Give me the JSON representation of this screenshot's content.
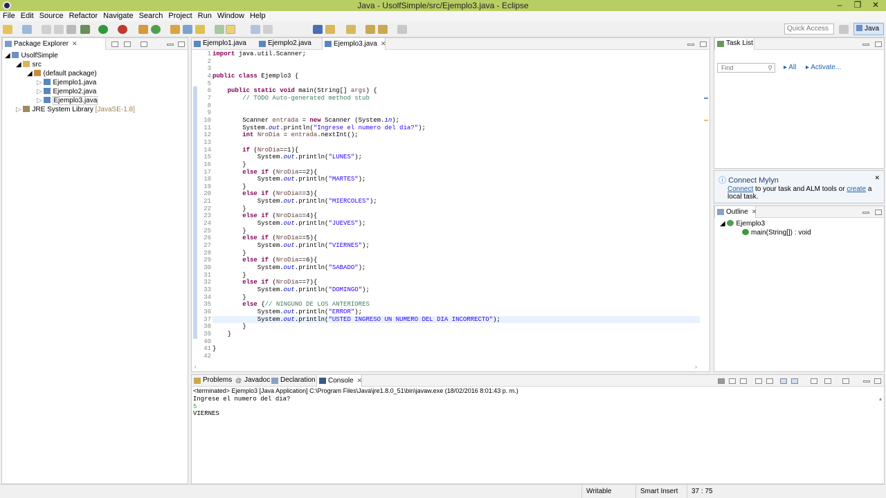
{
  "window": {
    "title": "Java - UsolfSimple/src/Ejemplo3.java - Eclipse"
  },
  "menu": [
    "File",
    "Edit",
    "Source",
    "Refactor",
    "Navigate",
    "Search",
    "Project",
    "Run",
    "Window",
    "Help"
  ],
  "toolbar": {
    "quick_access_placeholder": "Quick Access",
    "perspective": "Java"
  },
  "package_explorer": {
    "tab": "Package Explorer",
    "project": "UsolfSimple",
    "src": "src",
    "package": "(default package)",
    "files": [
      "Ejemplo1.java",
      "Ejemplo2.java",
      "Ejemplo3.java"
    ],
    "library": "JRE System Library",
    "library_version": "[JavaSE-1.8]"
  },
  "editor": {
    "tabs": [
      "Ejemplo1.java",
      "Ejemplo2.java",
      "Ejemplo3.java"
    ],
    "active_tab": "Ejemplo3.java",
    "lines": [
      "import java.util.Scanner;",
      "",
      "",
      "public class Ejemplo3 {",
      "",
      "    public static void main(String[] args) {",
      "        // TODO Auto-generated method stub",
      "",
      "",
      "        Scanner entrada = new Scanner (System.in);",
      "        System.out.println(\"Ingrese el numero del dia?\");",
      "        int NroDia = entrada.nextInt();",
      "",
      "        if (NroDia==1){",
      "            System.out.println(\"LUNES\");",
      "        }",
      "        else if (NroDia==2){",
      "            System.out.println(\"MARTES\");",
      "        }",
      "        else if (NroDia==3){",
      "            System.out.println(\"MIERCOLES\");",
      "        }",
      "        else if (NroDia==4){",
      "            System.out.println(\"JUEVES\");",
      "        }",
      "        else if (NroDia==5){",
      "            System.out.println(\"VIERNES\");",
      "        }",
      "        else if (NroDia==6){",
      "            System.out.println(\"SABADO\");",
      "        }",
      "        else if (NroDia==7){",
      "            System.out.println(\"DOMINGO\");",
      "        }",
      "        else {// NINGUNO DE LOS ANTERIORES",
      "            System.out.println(\"ERROR\");",
      "            System.out.println(\"USTED INGRESO UN NUMERO DEL DIA INCORRECTO\");",
      "        }",
      "    }",
      "",
      "}",
      ""
    ],
    "current_line": 37
  },
  "task_list": {
    "tab": "Task List",
    "find_placeholder": "Find",
    "all": "All",
    "activate": "Activate..."
  },
  "mylyn": {
    "title": "Connect Mylyn",
    "connect_link": "Connect",
    "text_mid": " to your task and ALM tools or ",
    "create_link": "create",
    "text_end": " a local task."
  },
  "outline": {
    "tab": "Outline",
    "class": "Ejemplo3",
    "method": "main(String[]) : void"
  },
  "bottom_tabs": [
    "Problems",
    "Javadoc",
    "Declaration",
    "Console"
  ],
  "console": {
    "header": "<terminated> Ejemplo3 [Java Application] C:\\Program Files\\Java\\jre1.8.0_51\\bin\\javaw.exe (18/02/2016 8:01:43 p. m.)",
    "output": [
      "Ingrese el numero del dia?",
      "5",
      "VIERNES"
    ]
  },
  "status": {
    "writable": "Writable",
    "insert_mode": "Smart Insert",
    "position": "37 : 75"
  },
  "colors": {
    "titlebar": "#b8ce63",
    "keyword": "#7f0055",
    "string": "#2a00ff",
    "comment": "#3f7f5f"
  }
}
